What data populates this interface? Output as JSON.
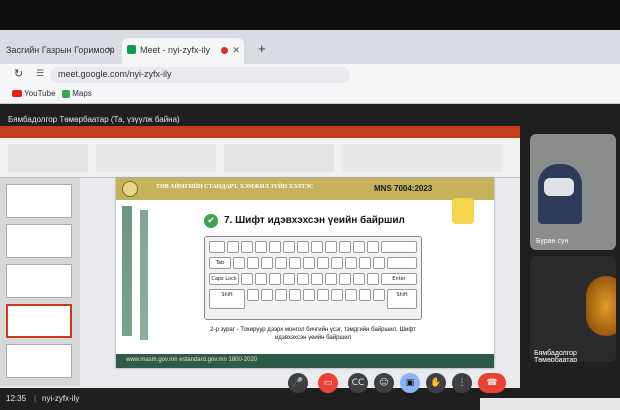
{
  "browser": {
    "tabs": [
      {
        "label": "Засгийн Газрын Горимоор"
      },
      {
        "label": "Meet - nyi-zyfx-ily"
      }
    ],
    "new_tab": "+",
    "address": "meet.google.com/nyi-zyfx-ily",
    "bookmarks": [
      {
        "label": "YouTube"
      },
      {
        "label": "Maps"
      }
    ]
  },
  "meet": {
    "presenter_banner": "Бямбадолгор Төмөрбаатар (Та, үзүүлж байна)",
    "slide": {
      "header_left": "ТӨВ АЙМГИЙН СТАНДАРТ, ХЭМЖИЛ ЗҮЙН ХЭЛТЭС",
      "header_right": "MNS 7004:2023",
      "title": "7. Шифт идэвхэхсэн үеийн байршил",
      "key_tab": "Tab",
      "key_caps": "Caps Lock",
      "key_shift": "Shift",
      "key_enter": "Enter",
      "caption": "2-р зураг - Тохируур дээрх монгол бичгийн үсэг, тэмдгийн байршил. Шифт идэвхэхсэн үеийн байршил",
      "footer": "www.masm.gov.mn   estandard.gov.mn   1800-2020"
    },
    "participants": [
      {
        "name": "Буран сун"
      },
      {
        "name": "Бямбадолгор Төмөрбаатар"
      }
    ],
    "bottom": {
      "time": "12:35",
      "separator": "|",
      "code": "nyi-zyfx-ily"
    }
  },
  "colors": {
    "gold": "#c6b25a",
    "green": "#2f5a4a",
    "end_call": "#ea4335",
    "present": "#8ab4f8"
  }
}
